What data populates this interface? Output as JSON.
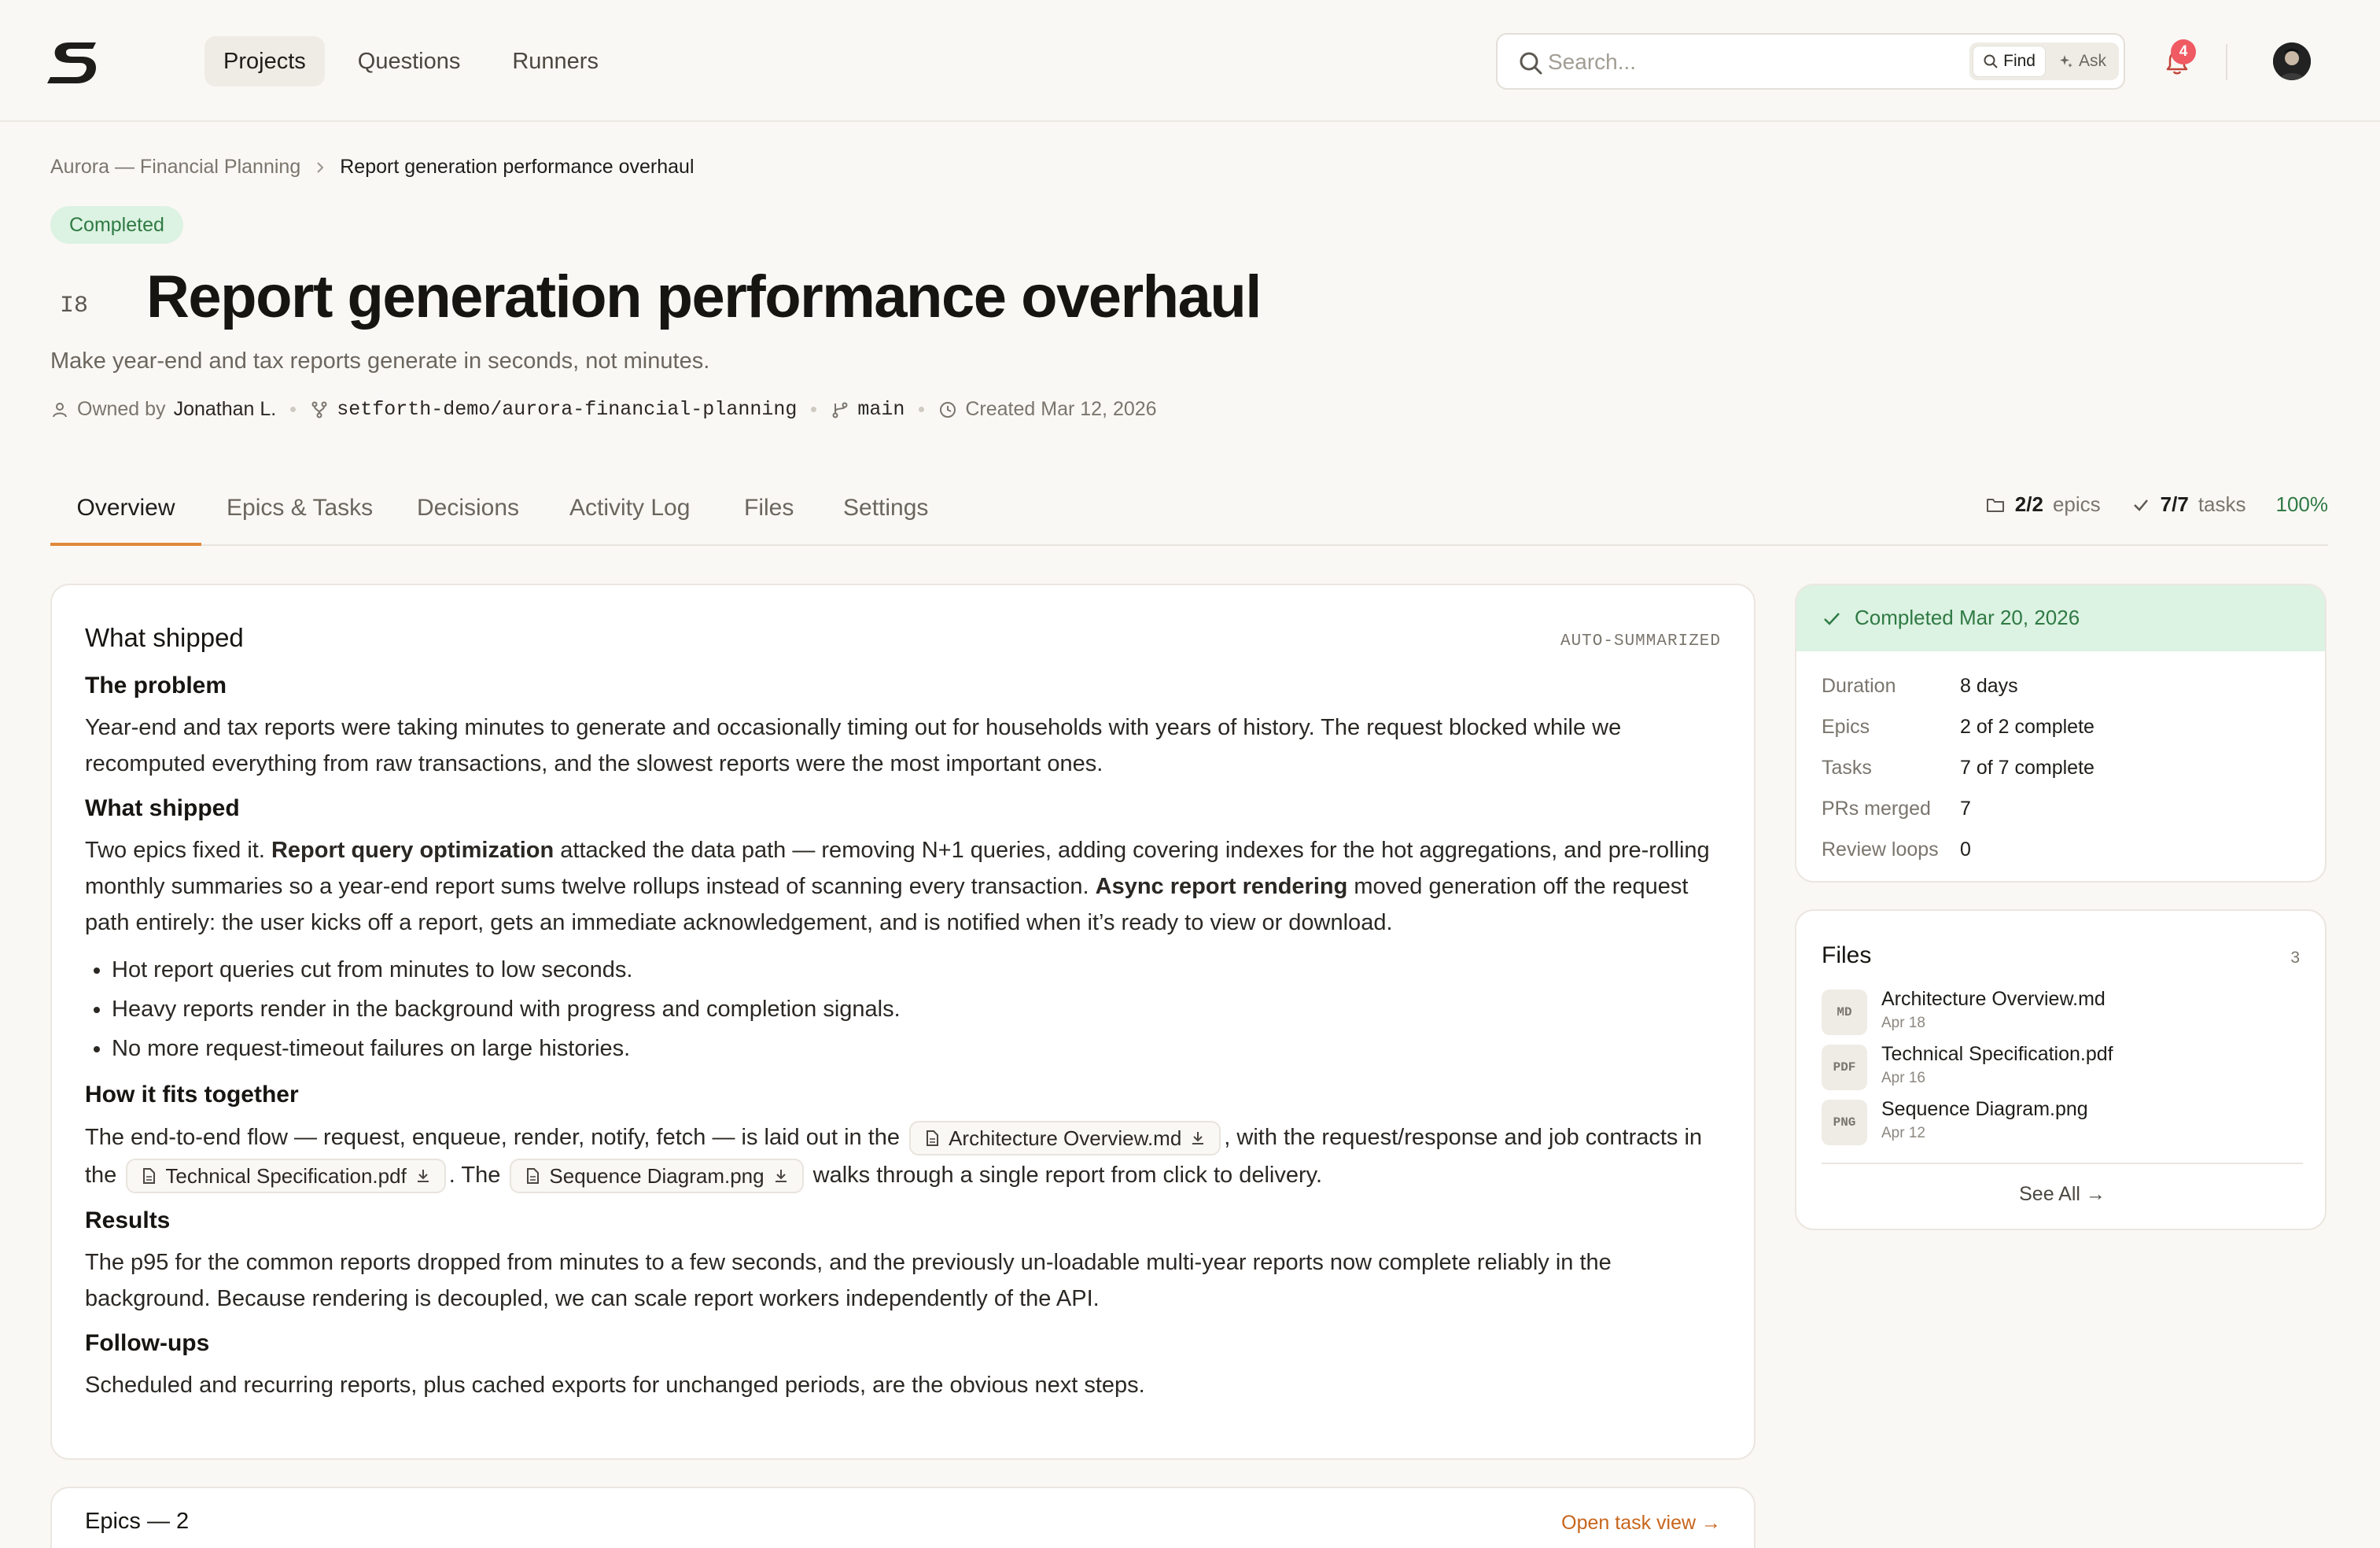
{
  "header": {
    "logo_alt": "S",
    "nav": [
      {
        "label": "Projects"
      },
      {
        "label": "Questions"
      },
      {
        "label": "Runners"
      }
    ],
    "search": {
      "placeholder": "Search...",
      "find_label": "Find",
      "ask_label": "Ask"
    },
    "notifications_count": "4"
  },
  "breadcrumb": {
    "root": "Aurora — Financial Planning",
    "current": "Report generation performance overhaul"
  },
  "project": {
    "status": "Completed",
    "code": "I8",
    "title": "Report generation performance overhaul",
    "subtitle": "Make year-end and tax reports generate in seconds, not minutes.",
    "owner_prefix": "Owned by",
    "owner": "Jonathan L.",
    "repo": "setforth-demo/aurora-financial-planning",
    "branch": "main",
    "created": "Created Mar 12, 2026"
  },
  "tabs": [
    {
      "label": "Overview"
    },
    {
      "label": "Epics & Tasks"
    },
    {
      "label": "Decisions"
    },
    {
      "label": "Activity Log"
    },
    {
      "label": "Files"
    },
    {
      "label": "Settings"
    }
  ],
  "stats": {
    "epics_value": "2/2",
    "epics_label": "epics",
    "tasks_value": "7/7",
    "tasks_label": "tasks",
    "percent": "100%"
  },
  "summary": {
    "heading": "What shipped",
    "tag": "AUTO-SUMMARIZED",
    "problem_heading": "The problem",
    "problem_text": "Year-end and tax reports were taking minutes to generate and occasionally timing out for households with years of history. The request blocked while we recomputed everything from raw transactions, and the slowest reports were the most important ones.",
    "shipped_heading": "What shipped",
    "shipped_text_1": "Two epics fixed it. ",
    "shipped_bold_1": "Report query optimization",
    "shipped_text_2": " attacked the data path — removing N+1 queries, adding covering indexes for the hot aggregations, and pre-rolling monthly summaries so a year-end report sums twelve rollups instead of scanning every transaction. ",
    "shipped_bold_2": "Async report rendering",
    "shipped_text_3": " moved generation off the request path entirely: the user kicks off a report, gets an immediate acknowledgement, and is notified when it’s ready to view or download.",
    "bullets": [
      "Hot report queries cut from minutes to low seconds.",
      "Heavy reports render in the background with progress and completion signals.",
      "No more request-timeout failures on large histories."
    ],
    "fits_heading": "How it fits together",
    "fits_text_1": "The end-to-end flow — request, enqueue, render, notify, fetch — is laid out in the",
    "fits_chip_1": "Architecture Overview.md",
    "fits_text_2": ", with the request/response and job contracts in the",
    "fits_chip_2": "Technical Specification.pdf",
    "fits_text_3": ". The",
    "fits_chip_3": "Sequence Diagram.png",
    "fits_text_4": "walks through a single report from click to delivery.",
    "results_heading": "Results",
    "results_text": "The p95 for the common reports dropped from minutes to a few seconds, and the previously un-loadable multi-year reports now complete reliably in the background. Because rendering is decoupled, we can scale report workers independently of the API.",
    "followups_heading": "Follow-ups",
    "followups_text": "Scheduled and recurring reports, plus cached exports for unchanged periods, are the obvious next steps."
  },
  "completion": {
    "banner": "Completed Mar 20, 2026",
    "rows": [
      {
        "key": "Duration",
        "value": "8 days"
      },
      {
        "key": "Epics",
        "value": "2 of 2 complete"
      },
      {
        "key": "Tasks",
        "value": "7 of 7 complete"
      },
      {
        "key": "PRs merged",
        "value": "7"
      },
      {
        "key": "Review loops",
        "value": "0"
      }
    ]
  },
  "files": {
    "title": "Files",
    "count": "3",
    "items": [
      {
        "type": "MD",
        "name": "Architecture Overview.md",
        "date": "Apr 18"
      },
      {
        "type": "PDF",
        "name": "Technical Specification.pdf",
        "date": "Apr 16"
      },
      {
        "type": "PNG",
        "name": "Sequence Diagram.png",
        "date": "Apr 12"
      }
    ],
    "see_all": "See All →"
  },
  "epics": {
    "title": "Epics — 2",
    "link": "Open task view →"
  },
  "colors": {
    "accent": "#e0893a",
    "success": "#2f7a44",
    "success_bg": "#dcf2e2",
    "badge": "#ef5a63",
    "link": "#c8651c"
  }
}
